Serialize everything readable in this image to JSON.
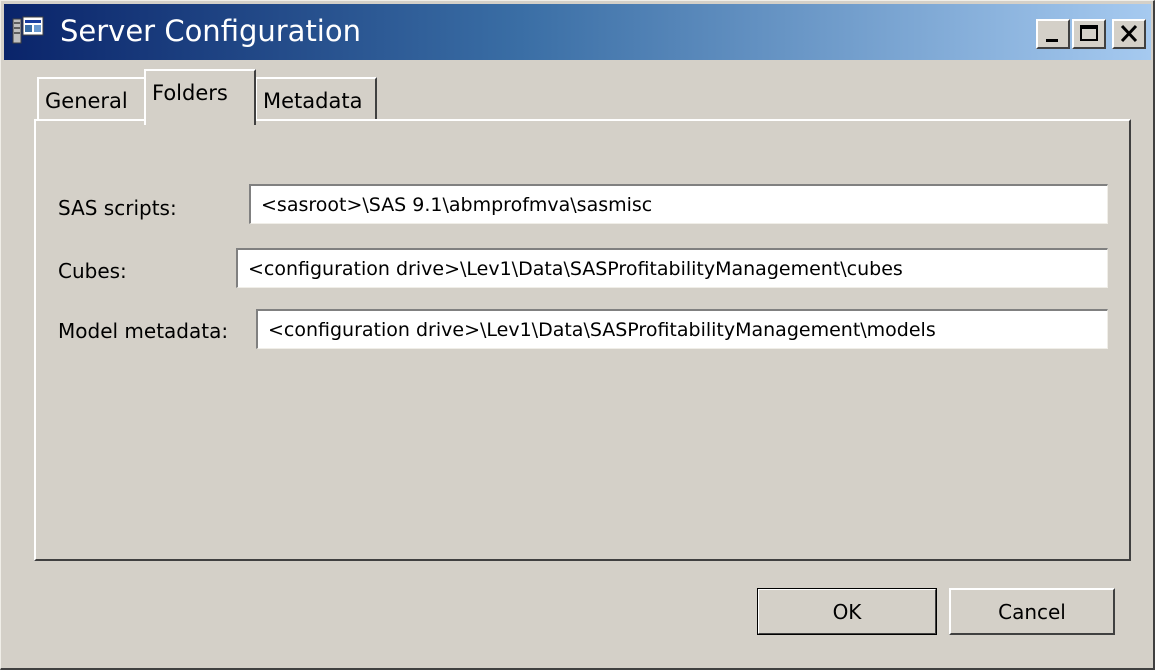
{
  "window": {
    "title": "Server Configuration",
    "icon": "server-config-icon"
  },
  "titlebar_buttons": {
    "minimize_icon": "minimize-icon",
    "maximize_icon": "maximize-icon",
    "close_icon": "close-icon"
  },
  "tabs": [
    {
      "label": "General",
      "selected": false
    },
    {
      "label": "Folders",
      "selected": true
    },
    {
      "label": "Metadata",
      "selected": false
    }
  ],
  "fields": {
    "sas_scripts": {
      "label": "SAS scripts:",
      "value": "<sasroot>\\SAS 9.1\\abmprofmva\\sasmisc"
    },
    "cubes": {
      "label": "Cubes:",
      "value": "<configuration drive>\\Lev1\\Data\\SASProfitabilityManagement\\cubes"
    },
    "model_metadata": {
      "label": "Model metadata:",
      "value": "<configuration drive>\\Lev1\\Data\\SASProfitabilityManagement\\models"
    }
  },
  "buttons": {
    "ok_label": "OK",
    "cancel_label": "Cancel"
  },
  "colors": {
    "titlebar_start": "#0a246a",
    "titlebar_end": "#a6caf0",
    "face": "#d4d0c8"
  }
}
